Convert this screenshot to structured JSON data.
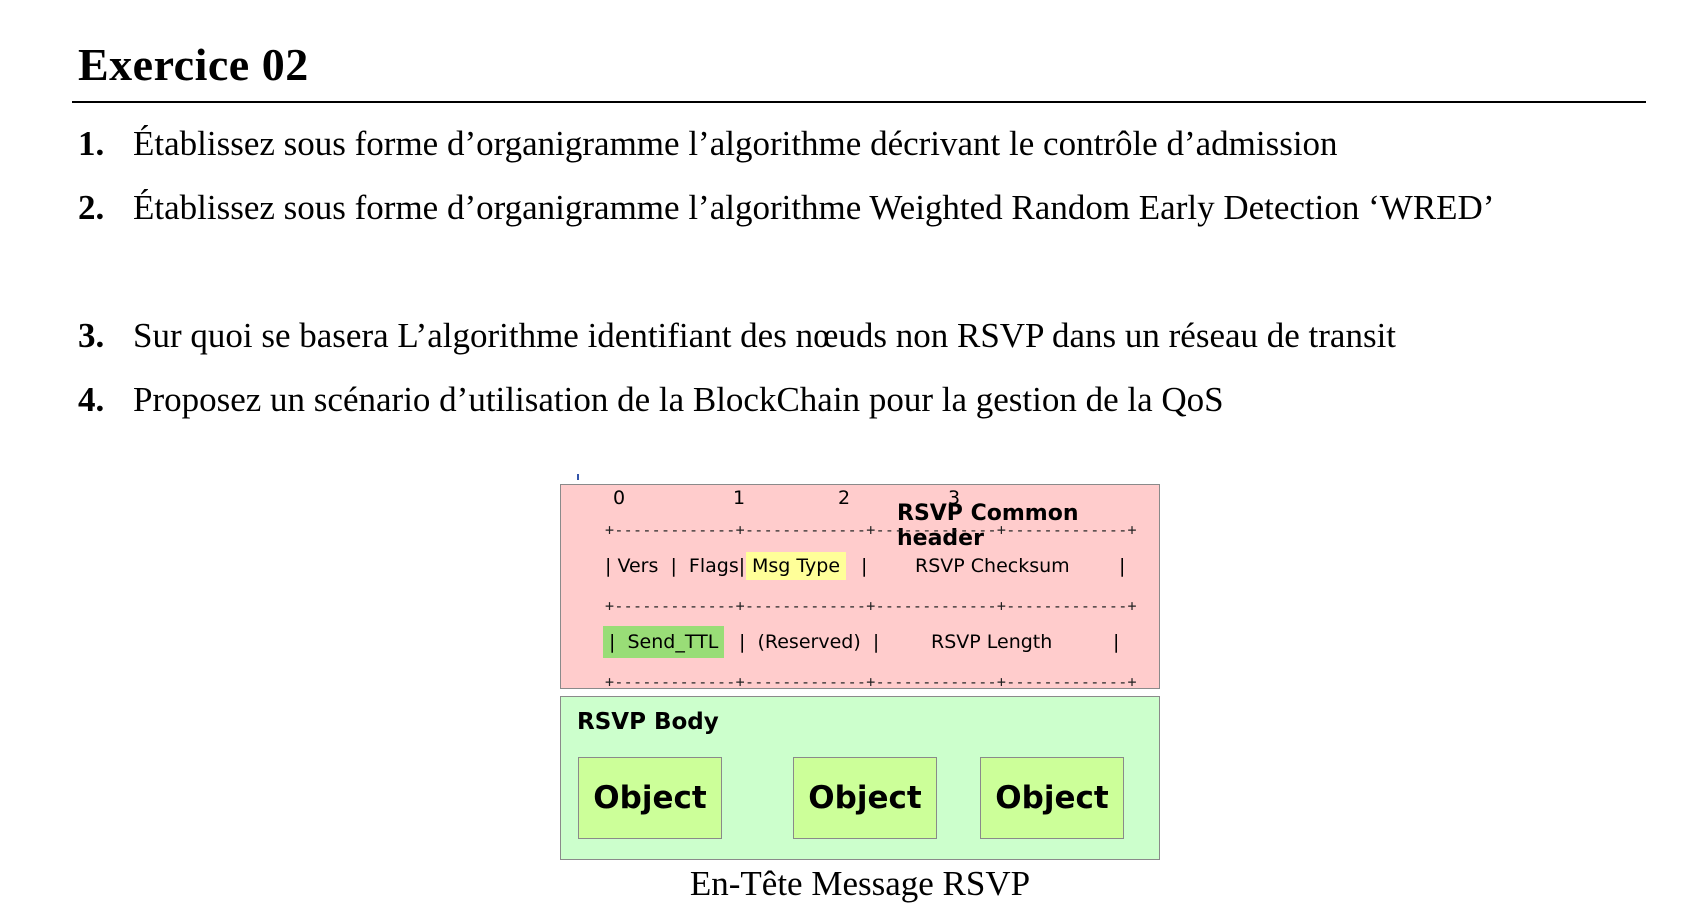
{
  "title": "Exercice 02",
  "questions": [
    {
      "num": "1.",
      "text": "Établissez sous forme d’organigramme l’algorithme décrivant le contrôle d’admission"
    },
    {
      "num": "2.",
      "text": "Établissez sous forme d’organigramme l’algorithme Weighted Random Early Detection ‘WRED’"
    },
    {
      "num": "3.",
      "text": "Sur quoi se basera L’algorithme identifiant des nœuds non RSVP dans un réseau de transit"
    },
    {
      "num": "4.",
      "text": "Proposez un scénario d’utilisation de la BlockChain pour la gestion de la QoS"
    }
  ],
  "diagram": {
    "bits": [
      "0",
      "1",
      "2",
      "3"
    ],
    "header_title": "RSVP Common header",
    "ruler": "+-------------+-------------+-------------+-------------+",
    "row1": {
      "vers_flags": "| Vers  |  Flags|",
      "msg_type": "Msg Type",
      "sep": "|",
      "checksum": "RSVP Checksum",
      "end": "|"
    },
    "row2": {
      "send_ttl": "|  Send_TTL",
      "reserved": "|  (Reserved)  |",
      "length": "RSVP Length",
      "end": "|"
    },
    "body_title": "RSVP Body",
    "objects": [
      "Object",
      "Object",
      "Object"
    ],
    "colors": {
      "header_bg": "#ffcccc",
      "body_bg": "#ccffcc",
      "object_bg": "#ccff99",
      "highlight_yellow": "#ffff99",
      "highlight_green": "#99dd77"
    }
  },
  "caption": "En-Tête Message RSVP"
}
